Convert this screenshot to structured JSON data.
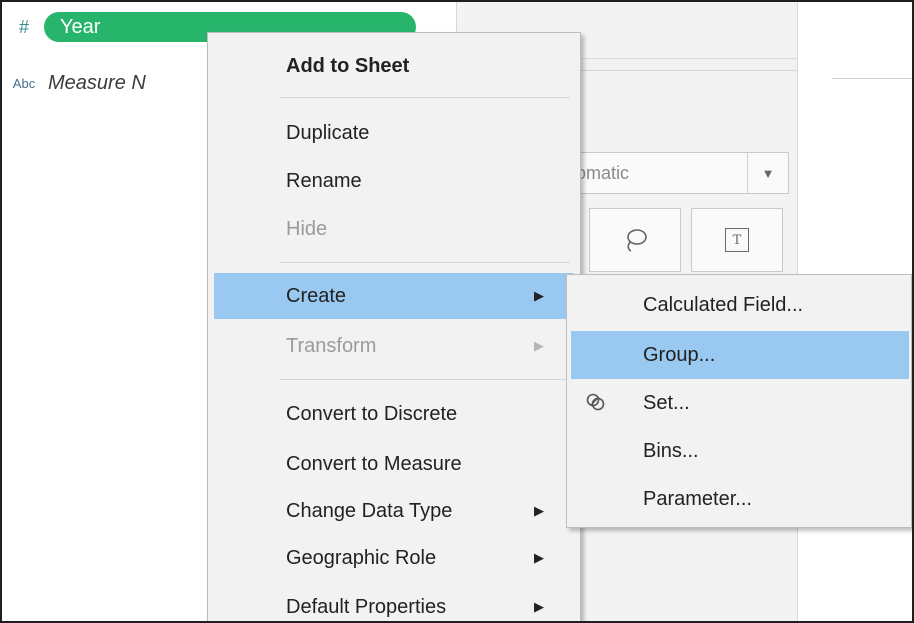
{
  "data_pane": {
    "fields": [
      {
        "type_icon": "#",
        "name": "Year"
      },
      {
        "type_icon": "Abc",
        "name": "Measure N"
      }
    ]
  },
  "marks": {
    "mark_type_partial": "omatic"
  },
  "context_menu": {
    "items": [
      {
        "label": "Add to Sheet"
      },
      {
        "label": "Duplicate"
      },
      {
        "label": "Rename"
      },
      {
        "label": "Hide"
      },
      {
        "label": "Create"
      },
      {
        "label": "Transform"
      },
      {
        "label": "Convert to Discrete"
      },
      {
        "label": "Convert to Measure"
      },
      {
        "label": "Change Data Type"
      },
      {
        "label": "Geographic Role"
      },
      {
        "label": "Default Properties"
      }
    ]
  },
  "create_submenu": {
    "items": [
      {
        "label": "Calculated Field..."
      },
      {
        "label": "Group..."
      },
      {
        "label": "Set..."
      },
      {
        "label": "Bins..."
      },
      {
        "label": "Parameter..."
      }
    ]
  },
  "colors": {
    "pill": "#27b56b",
    "highlight": "#99c8f0",
    "menu_bg": "#f2f2f2"
  }
}
